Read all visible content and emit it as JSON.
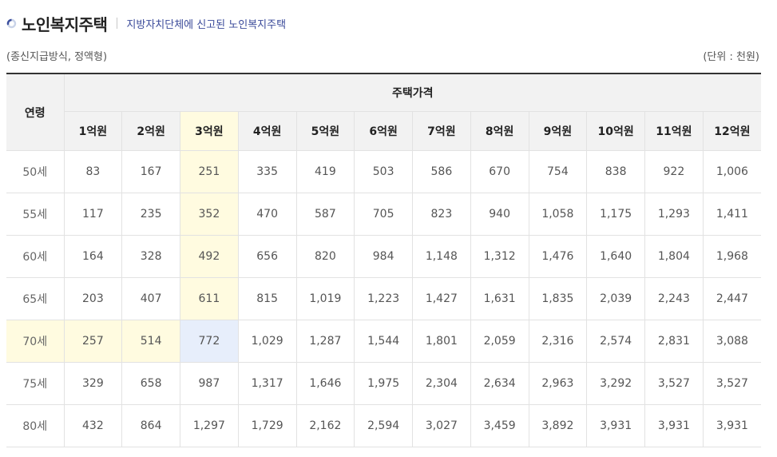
{
  "header": {
    "title": "노인복지주택",
    "subtitle": "지방자치단체에 신고된 노인복지주택"
  },
  "notes": {
    "left": "(종신지급방식, 정액형)",
    "right": "(단위 : 천원)"
  },
  "table": {
    "age_header": "연령",
    "group_header": "주택가격",
    "price_columns": [
      "1억원",
      "2억원",
      "3억원",
      "4억원",
      "5억원",
      "6억원",
      "7억원",
      "8억원",
      "9억원",
      "10억원",
      "11억원",
      "12억원"
    ],
    "rows": [
      {
        "age": "50세",
        "values": [
          "83",
          "167",
          "251",
          "335",
          "419",
          "503",
          "586",
          "670",
          "754",
          "838",
          "922",
          "1,006"
        ]
      },
      {
        "age": "55세",
        "values": [
          "117",
          "235",
          "352",
          "470",
          "587",
          "705",
          "823",
          "940",
          "1,058",
          "1,175",
          "1,293",
          "1,411"
        ]
      },
      {
        "age": "60세",
        "values": [
          "164",
          "328",
          "492",
          "656",
          "820",
          "984",
          "1,148",
          "1,312",
          "1,476",
          "1,640",
          "1,804",
          "1,968"
        ]
      },
      {
        "age": "65세",
        "values": [
          "203",
          "407",
          "611",
          "815",
          "1,019",
          "1,223",
          "1,427",
          "1,631",
          "1,835",
          "2,039",
          "2,243",
          "2,447"
        ]
      },
      {
        "age": "70세",
        "values": [
          "257",
          "514",
          "772",
          "1,029",
          "1,287",
          "1,544",
          "1,801",
          "2,059",
          "2,316",
          "2,574",
          "2,831",
          "3,088"
        ]
      },
      {
        "age": "75세",
        "values": [
          "329",
          "658",
          "987",
          "1,317",
          "1,646",
          "1,975",
          "2,304",
          "2,634",
          "2,963",
          "3,292",
          "3,527",
          "3,527"
        ]
      },
      {
        "age": "80세",
        "values": [
          "432",
          "864",
          "1,297",
          "1,729",
          "2,162",
          "2,594",
          "3,027",
          "3,459",
          "3,892",
          "3,931",
          "3,931",
          "3,931"
        ]
      }
    ],
    "highlight": {
      "column_label": "3억원",
      "row_label": "70세",
      "column_color": "#fffbe0",
      "intersection_color": "#e7eefb"
    }
  }
}
